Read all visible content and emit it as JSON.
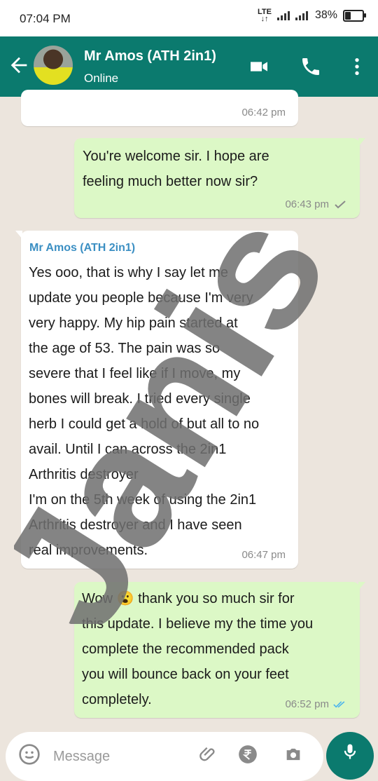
{
  "status_bar": {
    "time": "07:04 PM",
    "network": "LTE",
    "battery_percent_label": "38%",
    "battery_level": 0.38
  },
  "header": {
    "contact_name": "Mr Amos (ATH 2in1)",
    "contact_status": "Online",
    "icons": [
      "back-arrow-icon",
      "video-call-icon",
      "phone-icon",
      "more-vert-icon"
    ],
    "color": "#0b7a6e"
  },
  "messages": [
    {
      "direction": "incoming",
      "text": "",
      "time": "06:42 pm"
    },
    {
      "direction": "outgoing",
      "text_lines": [
        "You're welcome sir. I hope are",
        "feeling much better now sir?"
      ],
      "time": "06:43 pm",
      "status": "sent"
    },
    {
      "direction": "incoming",
      "sender": "Mr Amos (ATH 2in1)",
      "text_lines": [
        "Yes ooo, that is why I say let me",
        "update you people because I'm very",
        "very happy. My hip pain started at",
        "the age of 53. The pain was so",
        "severe that I feel like if I move, my",
        "bones will break. I tried every single",
        "herb I could get a hold of but all to no",
        "avail. Until I can across the 2in1",
        "Arthritis destroyer",
        "I'm on the 5th week of using the 2in1",
        "Arthritis destroyer and I have seen",
        "real improvements."
      ],
      "time": "06:47 pm"
    },
    {
      "direction": "outgoing",
      "text_lines": [
        "Wow 😮 thank you so much sir for",
        "this update. I believe my the time you",
        "complete the recommended pack",
        "you will bounce back on your feet",
        "completely."
      ],
      "time": "06:52 pm",
      "status": "read"
    }
  ],
  "watermark": "Janis",
  "input": {
    "placeholder": "Message"
  },
  "colors": {
    "chat_background": "#ece5dd",
    "outgoing_bubble": "#dcf8c6",
    "incoming_bubble": "#ffffff",
    "read_tick": "#4fb6ec",
    "sender_name": "#3b8fc3"
  }
}
